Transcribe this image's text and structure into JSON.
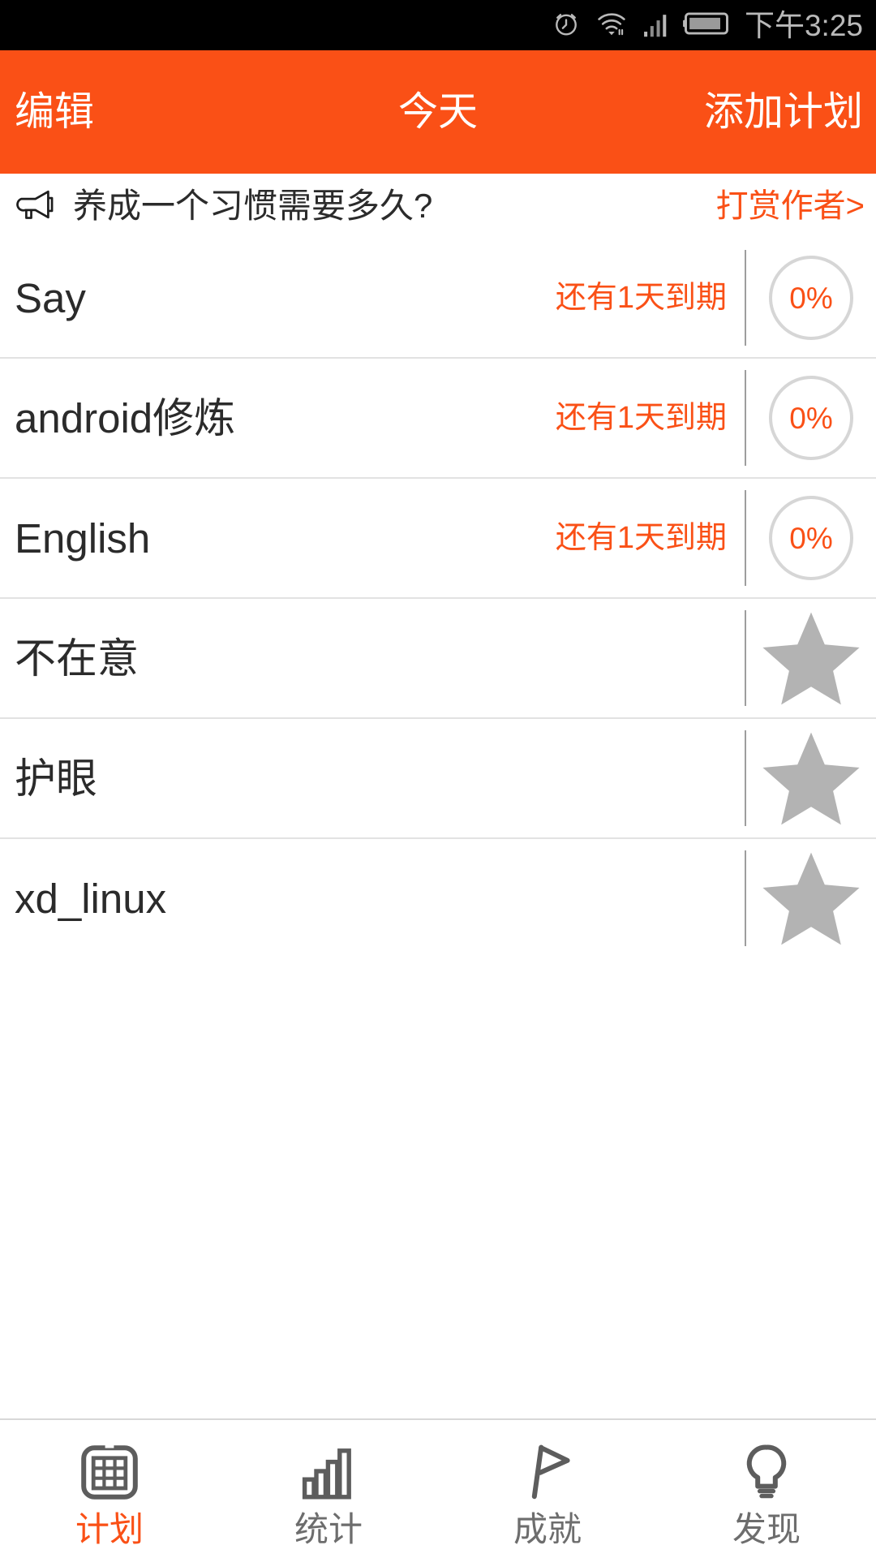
{
  "status_bar": {
    "time": "下午3:25",
    "icons": [
      "alarm-icon",
      "wifi-icon",
      "signal-icon",
      "battery-icon"
    ]
  },
  "app_bar": {
    "left_label": "编辑",
    "title": "今天",
    "right_label": "添加计划",
    "background_color": "#fa5016",
    "text_color": "#ffffff"
  },
  "banner": {
    "icon": "megaphone-icon",
    "text": "养成一个习惯需要多久?",
    "reward_label": "打赏作者>",
    "reward_color": "#fa5016"
  },
  "colors": {
    "accent": "#fa5016",
    "text": "#2b2b2b",
    "divider": "#e2e2e2",
    "ring_track": "#d6d6d6",
    "star_fill": "#b3b3b3"
  },
  "plans": [
    {
      "title": "Say",
      "due": "还有1天到期",
      "right_type": "ring",
      "progress": "0%",
      "progress_value": 0
    },
    {
      "title": "android修炼",
      "due": "还有1天到期",
      "right_type": "ring",
      "progress": "0%",
      "progress_value": 0
    },
    {
      "title": "English",
      "due": "还有1天到期",
      "right_type": "ring",
      "progress": "0%",
      "progress_value": 0
    },
    {
      "title": "不在意",
      "due": "",
      "right_type": "star",
      "progress": "",
      "progress_value": null
    },
    {
      "title": "护眼",
      "due": "",
      "right_type": "star",
      "progress": "",
      "progress_value": null
    },
    {
      "title": "xd_linux",
      "due": "",
      "right_type": "star",
      "progress": "",
      "progress_value": null
    }
  ],
  "tab_bar": {
    "active_index": 0,
    "tabs": [
      {
        "label": "计划",
        "icon": "calendar-grid-icon"
      },
      {
        "label": "统计",
        "icon": "bar-chart-icon"
      },
      {
        "label": "成就",
        "icon": "flag-icon"
      },
      {
        "label": "发现",
        "icon": "lightbulb-icon"
      }
    ]
  }
}
